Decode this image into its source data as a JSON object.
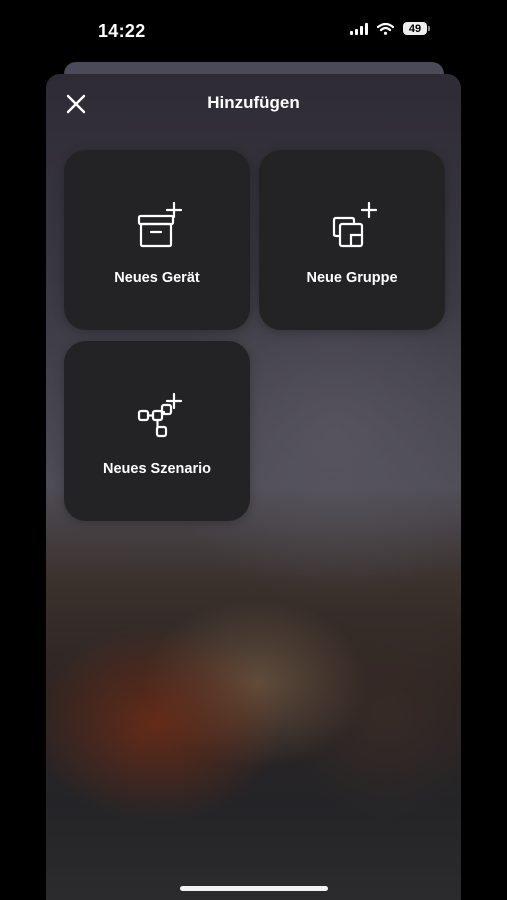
{
  "status_bar": {
    "time": "14:22",
    "battery": "49",
    "icons": [
      "cellular-signal-icon",
      "wifi-icon",
      "battery-icon"
    ]
  },
  "sheet": {
    "title": "Hinzufügen",
    "close_icon": "close-icon"
  },
  "tiles": [
    {
      "label": "Neues Gerät",
      "icon": "add-device-icon"
    },
    {
      "label": "Neue Gruppe",
      "icon": "add-group-icon"
    },
    {
      "label": "Neues Szenario",
      "icon": "add-scenario-icon"
    }
  ],
  "colors": {
    "tile_background": "#232325",
    "text": "#ffffff"
  }
}
